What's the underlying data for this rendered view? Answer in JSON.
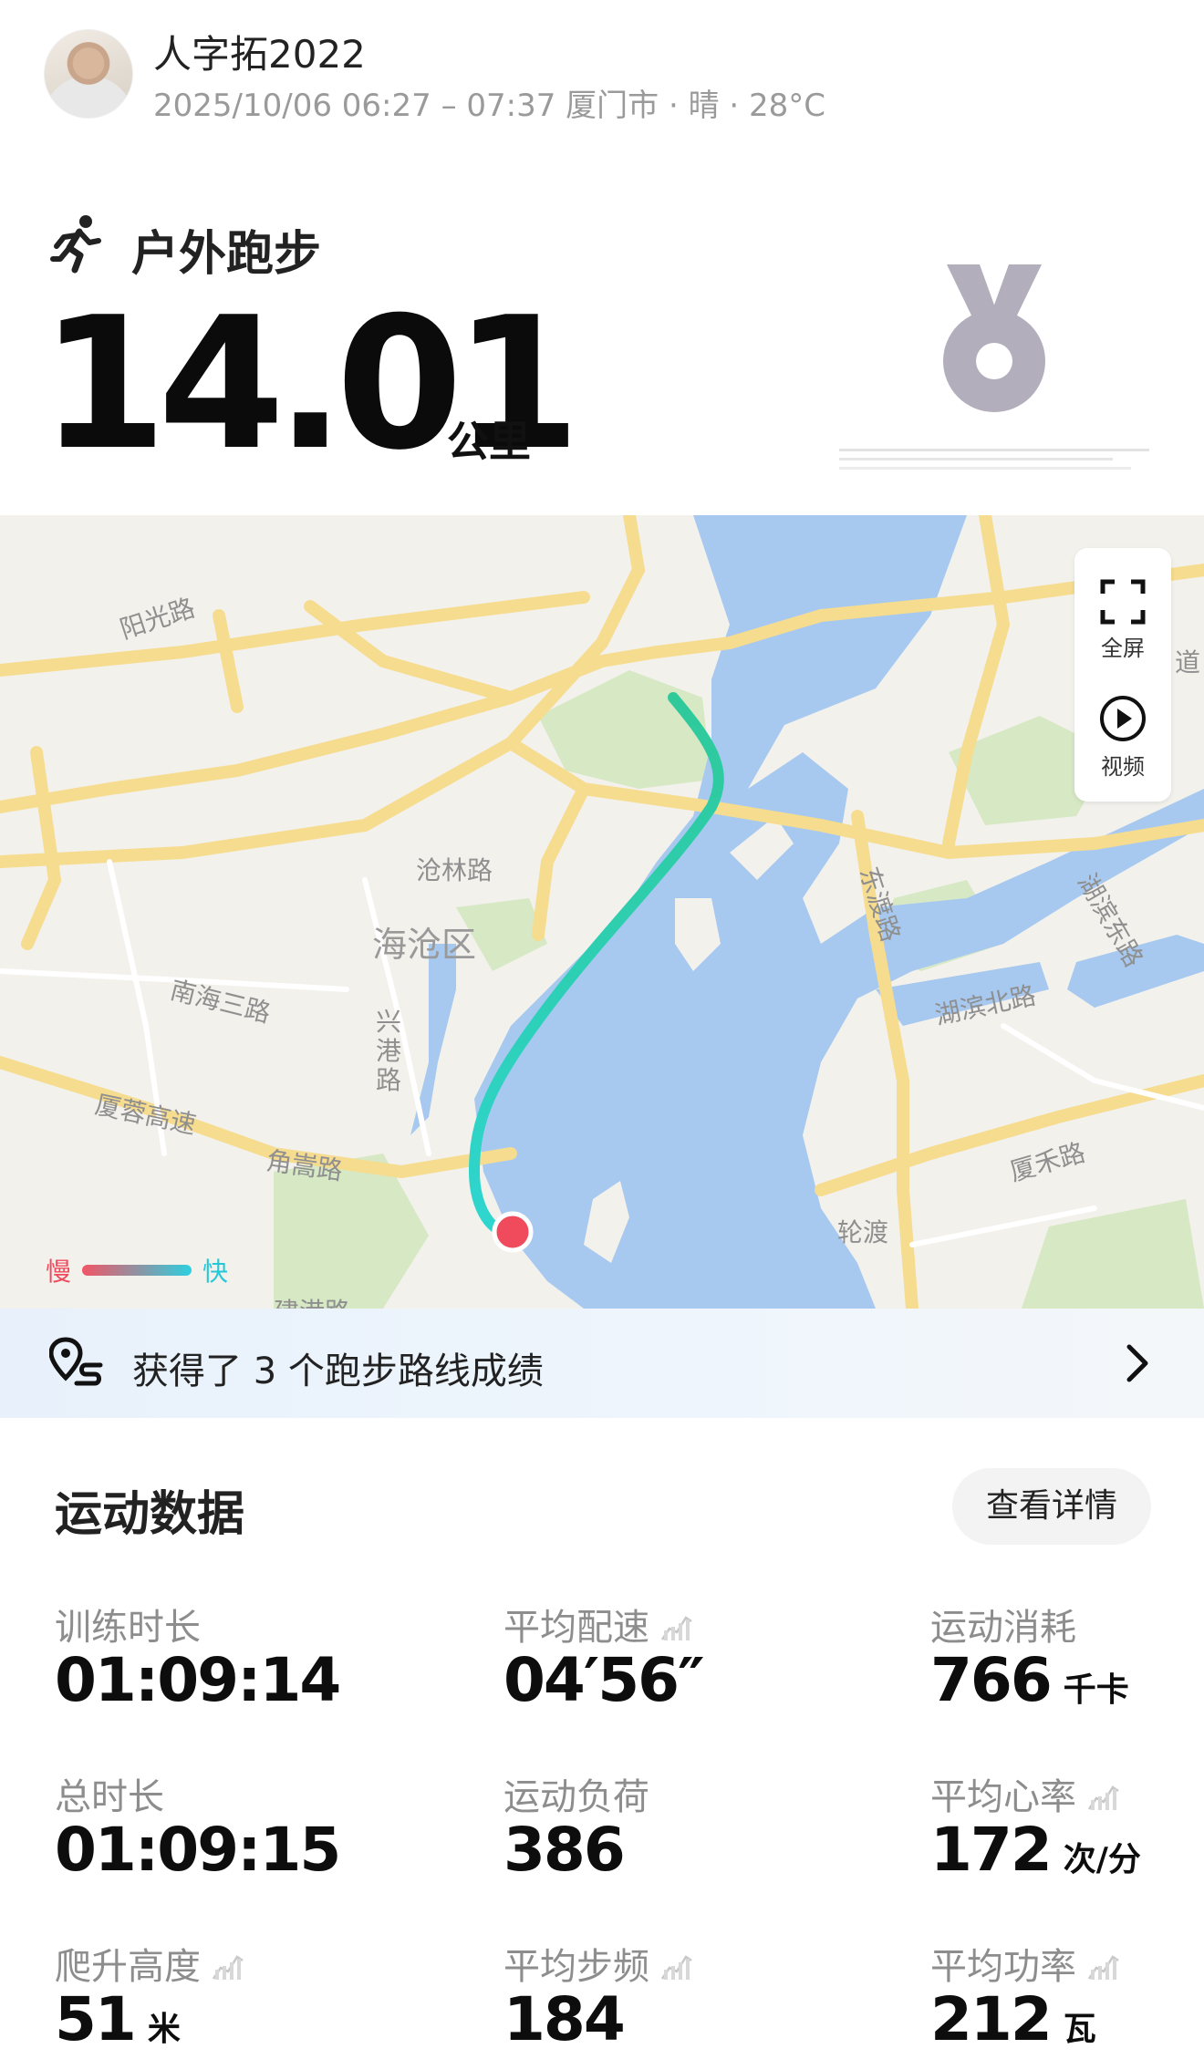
{
  "header": {
    "user_name": "人字拓2022",
    "meta": "2025/10/06 06:27 – 07:37 厦门市 · 晴 · 28°C"
  },
  "workout": {
    "sport": "户外跑步",
    "distance": "14.01",
    "distance_unit": "公里"
  },
  "map": {
    "labels": {
      "yangguang": "阳光路",
      "canglin": "沧林路",
      "haicang": "海沧区",
      "nanhai": "南海三路",
      "xinggang": "兴港路",
      "xiarong": "厦蓉高速",
      "jiaosong": "角嵩路",
      "jiangang": "建港路",
      "dongdu": "东渡路",
      "hubin_east": "湖滨东路",
      "hubin_north": "湖滨北路",
      "xiahe": "厦禾路",
      "lundu": "轮渡",
      "edge": "道"
    },
    "controls": {
      "fullscreen": "全屏",
      "video": "视频"
    },
    "legend": {
      "slow": "慢",
      "fast": "快"
    },
    "colors": {
      "water": "#a7c9f0",
      "road": "#f6dc8f",
      "park": "#d6e8c4",
      "route_slow": "#f25565",
      "route_fast": "#2dd0c4"
    }
  },
  "banner": {
    "text": "获得了 3 个跑步路线成绩"
  },
  "stats": {
    "title": "运动数据",
    "details_button": "查看详情",
    "items": [
      {
        "label": "训练时长",
        "value": "01:09:14",
        "unit": ""
      },
      {
        "label": "平均配速",
        "value": "04′56″",
        "unit": ""
      },
      {
        "label": "运动消耗",
        "value": "766",
        "unit": "千卡"
      },
      {
        "label": "总时长",
        "value": "01:09:15",
        "unit": ""
      },
      {
        "label": "运动负荷",
        "value": "386",
        "unit": ""
      },
      {
        "label": "平均心率",
        "value": "172",
        "unit": "次/分"
      },
      {
        "label": "爬升高度",
        "value": "51",
        "unit": "米"
      },
      {
        "label": "平均步频",
        "value": "184",
        "unit": ""
      },
      {
        "label": "平均功率",
        "value": "212",
        "unit": "瓦"
      }
    ]
  }
}
